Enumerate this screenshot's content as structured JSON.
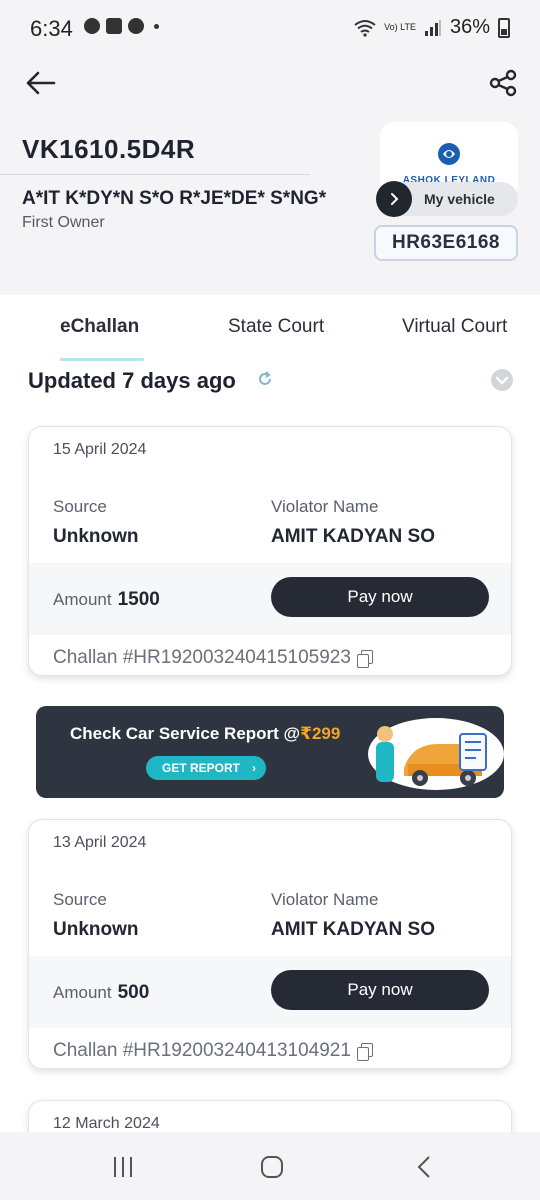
{
  "status_bar": {
    "time": "6:34",
    "battery": "36%",
    "network": "Vo) LTE"
  },
  "header": {
    "vehicle_reg": "VK1610.5D4R",
    "owner_name": "A*IT K*DY*N S*O R*JE*DE* S*NG*",
    "owner_type": "First Owner",
    "brand": "ASHOK LEYLAND",
    "my_vehicle_label": "My vehicle",
    "plate": "HR63E6168"
  },
  "tabs": [
    {
      "label": "eChallan",
      "active": true
    },
    {
      "label": "State Court",
      "active": false
    },
    {
      "label": "Virtual Court",
      "active": false
    }
  ],
  "updated": "Updated 7 days ago",
  "challans": [
    {
      "date": "15 April 2024",
      "source_label": "Source",
      "source_value": "Unknown",
      "violator_label": "Violator Name",
      "violator_value": "AMIT KADYAN SO",
      "amount_label": "Amount",
      "amount_value": "1500",
      "pay_label": "Pay now",
      "challan_no": "Challan #HR192003240415105923"
    },
    {
      "date": "13 April 2024",
      "source_label": "Source",
      "source_value": "Unknown",
      "violator_label": "Violator Name",
      "violator_value": "AMIT KADYAN SO",
      "amount_label": "Amount",
      "amount_value": "500",
      "pay_label": "Pay now",
      "challan_no": "Challan #HR192003240413104921"
    },
    {
      "date": "12 March 2024"
    }
  ],
  "banner": {
    "title": "Check Car Service Report @",
    "price": "₹299",
    "button": "GET REPORT"
  },
  "colors": {
    "accent_dark": "#262a35",
    "teal": "#1fb7c4",
    "price_orange": "#f5a623",
    "brand_blue": "#1a5fb4"
  }
}
